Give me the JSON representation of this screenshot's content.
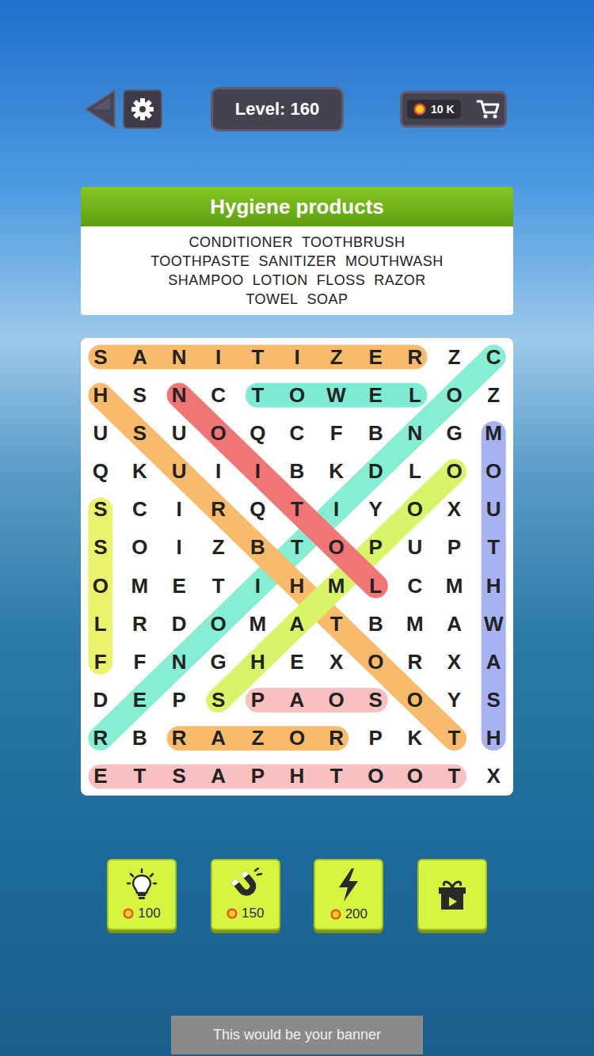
{
  "top_bar": {
    "level": "Level: 160",
    "coins": "10 K"
  },
  "category": "Hygiene products",
  "word_list": [
    [
      "CONDITIONER",
      "TOOTHBRUSH"
    ],
    [
      "TOOTHPASTE",
      "SANITIZER",
      "MOUTHWASH"
    ],
    [
      "SHAMPOO",
      "LOTION",
      "FLOSS",
      "RAZOR"
    ],
    [
      "TOWEL",
      "SOAP"
    ]
  ],
  "grid": [
    [
      "S",
      "A",
      "N",
      "I",
      "T",
      "I",
      "Z",
      "E",
      "R",
      "Z",
      "C"
    ],
    [
      "H",
      "S",
      "N",
      "C",
      "T",
      "O",
      "W",
      "E",
      "L",
      "O",
      "Z"
    ],
    [
      "U",
      "S",
      "U",
      "O",
      "Q",
      "C",
      "F",
      "B",
      "N",
      "G",
      "M"
    ],
    [
      "Q",
      "K",
      "U",
      "I",
      "I",
      "B",
      "K",
      "D",
      "L",
      "O",
      "O"
    ],
    [
      "S",
      "C",
      "I",
      "R",
      "Q",
      "T",
      "I",
      "Y",
      "O",
      "X",
      "U"
    ],
    [
      "S",
      "O",
      "I",
      "Z",
      "B",
      "T",
      "O",
      "P",
      "U",
      "P",
      "T"
    ],
    [
      "O",
      "M",
      "E",
      "T",
      "I",
      "H",
      "M",
      "L",
      "C",
      "M",
      "H"
    ],
    [
      "L",
      "R",
      "D",
      "O",
      "M",
      "A",
      "T",
      "B",
      "M",
      "A",
      "W"
    ],
    [
      "F",
      "F",
      "N",
      "G",
      "H",
      "E",
      "X",
      "O",
      "R",
      "X",
      "A"
    ],
    [
      "D",
      "E",
      "P",
      "S",
      "P",
      "A",
      "O",
      "S",
      "O",
      "Y",
      "S"
    ],
    [
      "R",
      "B",
      "R",
      "A",
      "Z",
      "O",
      "R",
      "P",
      "K",
      "T",
      "H"
    ],
    [
      "E",
      "T",
      "S",
      "A",
      "P",
      "H",
      "T",
      "O",
      "O",
      "T",
      "X"
    ]
  ],
  "found_words": [
    {
      "start": [
        0,
        10
      ],
      "end": [
        10,
        0
      ],
      "color": "#86eed2"
    },
    {
      "start": [
        1,
        0
      ],
      "end": [
        10,
        9
      ],
      "color": "#f8bb6b"
    },
    {
      "start": [
        9,
        3
      ],
      "end": [
        3,
        9
      ],
      "color": "#d8f56a"
    },
    {
      "start": [
        1,
        2
      ],
      "end": [
        6,
        7
      ],
      "color": "#f07575"
    },
    {
      "start": [
        0,
        0
      ],
      "end": [
        0,
        8
      ],
      "color": "#f8bb6b"
    },
    {
      "start": [
        1,
        4
      ],
      "end": [
        1,
        8
      ],
      "color": "#7eecd4"
    },
    {
      "start": [
        2,
        10
      ],
      "end": [
        10,
        10
      ],
      "color": "#a7b2f2"
    },
    {
      "start": [
        4,
        0
      ],
      "end": [
        8,
        0
      ],
      "color": "#ebf26b"
    },
    {
      "start": [
        9,
        4
      ],
      "end": [
        9,
        7
      ],
      "color": "#f8c0c0"
    },
    {
      "start": [
        10,
        2
      ],
      "end": [
        10,
        6
      ],
      "color": "#f8bb6b"
    },
    {
      "start": [
        11,
        0
      ],
      "end": [
        11,
        9
      ],
      "color": "#f8c0c0"
    }
  ],
  "boosters": [
    {
      "kind": "hint",
      "cost": "100"
    },
    {
      "kind": "magnet",
      "cost": "150"
    },
    {
      "kind": "bolt",
      "cost": "200"
    },
    {
      "kind": "video"
    }
  ],
  "banner": "This would be your banner"
}
